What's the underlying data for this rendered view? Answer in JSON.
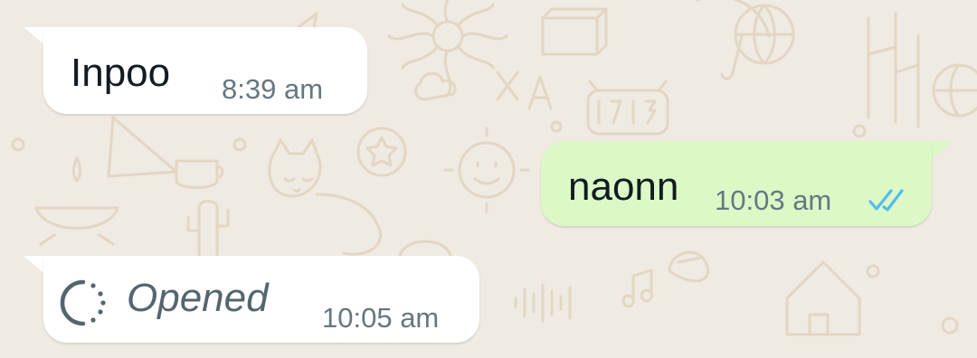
{
  "colors": {
    "chat_background": "#efeae2",
    "incoming_bubble": "#ffffff",
    "outgoing_bubble": "#dcf8c6",
    "text": "#111b21",
    "meta_text": "#667781",
    "read_ticks": "#53bdeb"
  },
  "messages": [
    {
      "direction": "incoming",
      "text": "Inpoo",
      "time": "8:39 am"
    },
    {
      "direction": "outgoing",
      "text": "naonn",
      "time": "10:03 am",
      "status_icon": "double-check-read-icon"
    },
    {
      "direction": "incoming",
      "text": "Opened",
      "time": "10:05 am",
      "icon": "view-once-opened-icon"
    }
  ]
}
